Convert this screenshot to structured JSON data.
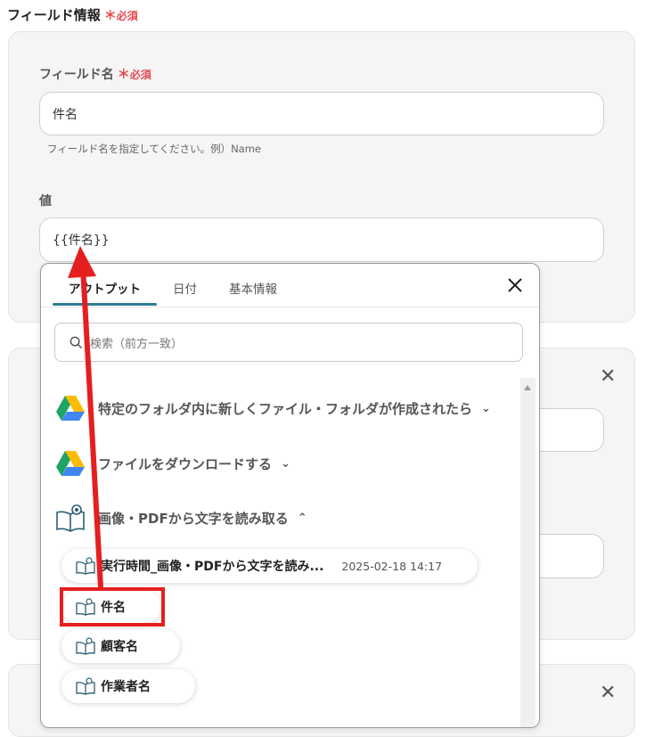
{
  "field_info": {
    "title": "フィールド情報",
    "required_mark": "＊",
    "required_text": "必須"
  },
  "field_name": {
    "label": "フィールド名",
    "required_mark": "＊",
    "required_text": "必須",
    "value": "件名",
    "hint": "フィールド名を指定してください。例）Name"
  },
  "value_field": {
    "label": "値",
    "value": "{{件名}}"
  },
  "dropdown": {
    "tabs": [
      {
        "label": "アウトプット",
        "active": true
      },
      {
        "label": "日付",
        "active": false
      },
      {
        "label": "基本情報",
        "active": false
      }
    ],
    "search_placeholder": "検索（前方一致）",
    "groups": [
      {
        "label": "特定のフォルダ内に新しくファイル・フォルダが作成されたら",
        "icon": "google-drive-icon",
        "chevron": "⌄"
      },
      {
        "label": "ファイルをダウンロードする",
        "icon": "google-drive-icon",
        "chevron": "⌄"
      },
      {
        "label": "画像・PDFから文字を読み取る",
        "icon": "ocr-book-icon",
        "chevron": "⌃"
      }
    ],
    "items": [
      {
        "label": "実行時間_画像・PDFから文字を読み...",
        "timestamp": "2025-02-18 14:17"
      },
      {
        "label": "件名"
      },
      {
        "label": "顧客名"
      },
      {
        "label": "作業者名"
      }
    ]
  },
  "colors": {
    "required": "#e5484d",
    "tab_underline": "#2b7d95",
    "highlight": "#e51f1f"
  }
}
